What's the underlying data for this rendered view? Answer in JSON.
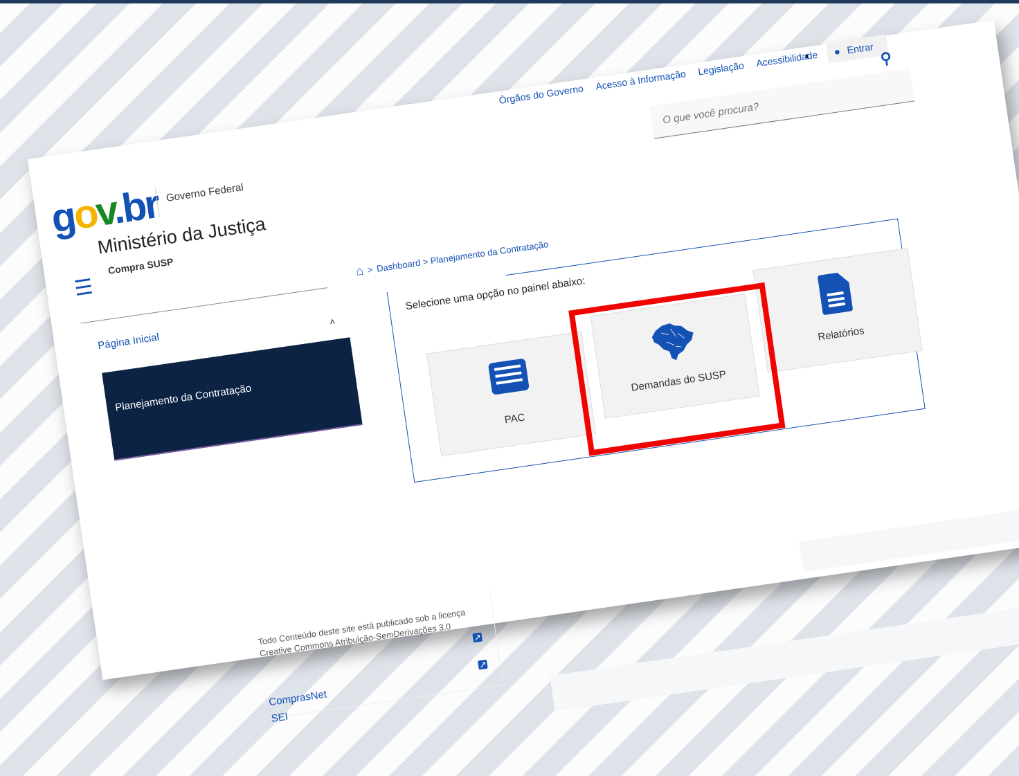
{
  "header": {
    "logo": "gov.br",
    "government_label": "Governo Federal",
    "ministry": "Ministério da Justiça",
    "system": "Compra  SUSP",
    "top_links": [
      "Órgãos do Governo",
      "Acesso à Informação",
      "Legislação",
      "Acessibilidade"
    ],
    "login_label": "Entrar",
    "search_placeholder": "O que você procura?"
  },
  "sidebar": {
    "home": "Página Inicial",
    "items": [
      {
        "label": "Planejamento da Contratação"
      }
    ]
  },
  "breadcrumb": {
    "separator": ">",
    "path": "Dashboard > Planejamento da Contratação"
  },
  "panel": {
    "title": "Selecione uma opção no painel abaixo:",
    "tiles": [
      {
        "label": "PAC",
        "icon": "list-icon"
      },
      {
        "label": "Demandas do  SUSP",
        "icon": "brazil-map-icon"
      },
      {
        "label": "Relatórios",
        "icon": "document-icon"
      }
    ],
    "highlighted_tile": "Demandas do  SUSP",
    "highlight_color": "#f00400",
    "accent_color": "#1351b4",
    "menu_color": "#0c2344"
  },
  "footer": {
    "license_text": "Todo Conteúdo deste site está publicado sob a licença Creative Commons Atribuição-SemDerivações 3.0",
    "links": [
      "ComprasNet",
      "SEI"
    ]
  }
}
